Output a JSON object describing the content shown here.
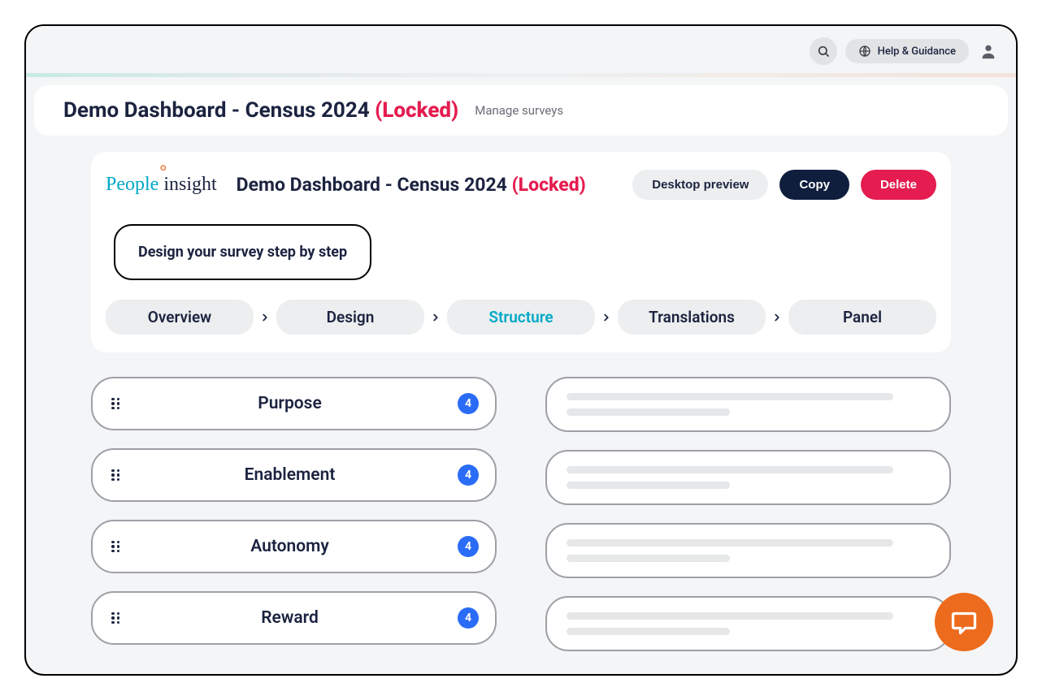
{
  "topbar": {
    "help_label": "Help & Guidance"
  },
  "title_card": {
    "title": "Demo Dashboard - Census 2024",
    "locked_label": "(Locked)",
    "manage_link": "Manage surveys"
  },
  "main": {
    "logo_text_a": "People",
    "logo_text_b": "insight",
    "title": "Demo Dashboard - Census 2024",
    "locked_label": "(Locked)",
    "btn_preview": "Desktop preview",
    "btn_copy": "Copy",
    "btn_delete": "Delete",
    "step_box": "Design your survey step by step"
  },
  "tabs": [
    {
      "label": "Overview",
      "active": false
    },
    {
      "label": "Design",
      "active": false
    },
    {
      "label": "Structure",
      "active": true
    },
    {
      "label": "Translations",
      "active": false
    },
    {
      "label": "Panel",
      "active": false
    }
  ],
  "categories": [
    {
      "label": "Purpose",
      "count": "4"
    },
    {
      "label": "Enablement",
      "count": "4"
    },
    {
      "label": "Autonomy",
      "count": "4"
    },
    {
      "label": "Reward",
      "count": "4"
    }
  ],
  "colors": {
    "accent_teal": "#00a9c7",
    "danger": "#e41c4f",
    "badge_blue": "#2b6cf6",
    "chat_orange": "#ed6b1c",
    "dark_navy": "#0f1e3d"
  }
}
